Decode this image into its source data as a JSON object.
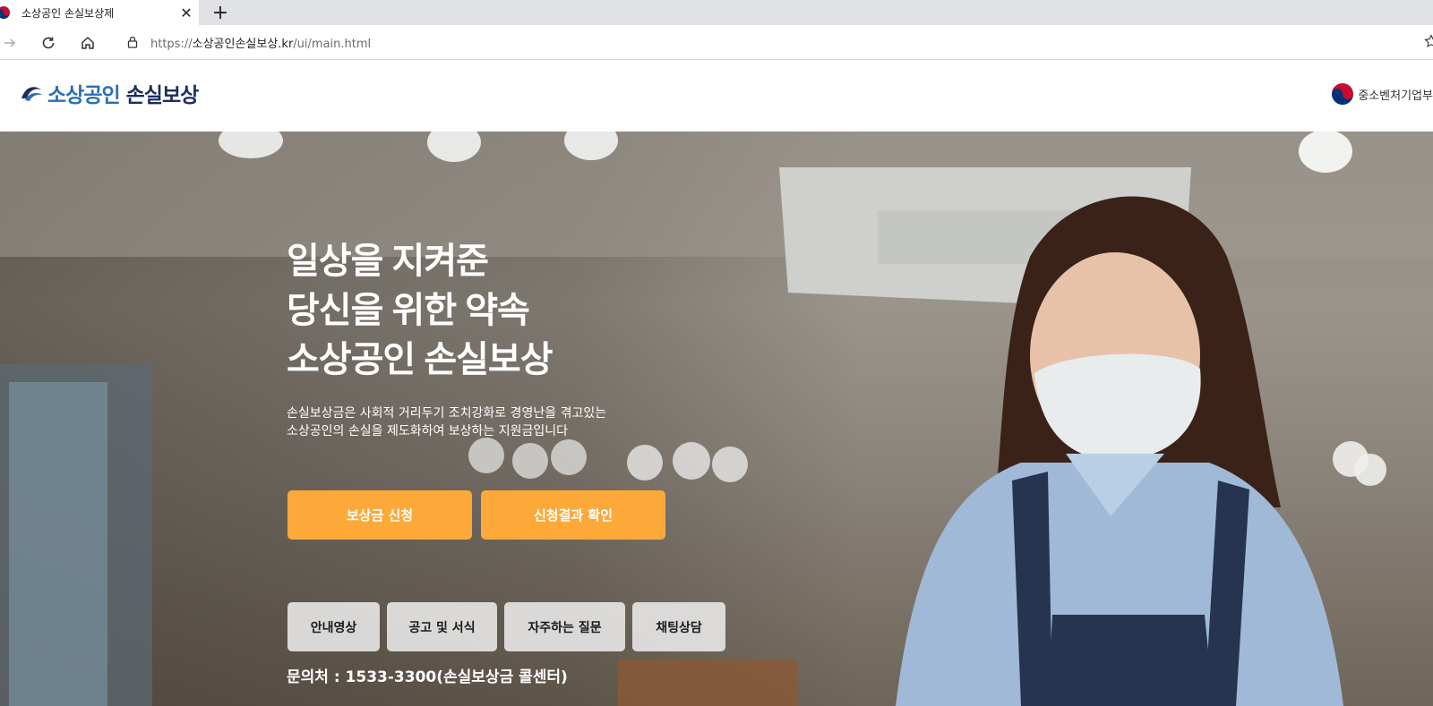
{
  "browser": {
    "tab_title": "소상공인 손실보상제",
    "url_scheme": "https://",
    "url_host": "소상공인손실보상.kr",
    "url_path": "/ui/main.html"
  },
  "header": {
    "logo_part1": "소상공인",
    "logo_part2": "손실보상",
    "ministry": "중소벤처기업부"
  },
  "hero": {
    "title_lines": [
      "일상을 지켜준",
      "당신을 위한 약속",
      "소상공인 손실보상"
    ],
    "desc_lines": [
      "손실보상금은 사회적 거리두기 조치강화로 경영난을 겪고있는",
      "소상공인의 손실을 제도화하여 보상하는 지원금입니다"
    ],
    "cta": [
      "보상금 신청",
      "신청결과 확인"
    ],
    "quick_links": [
      "안내영상",
      "공고 및 서식",
      "자주하는 질문",
      "채팅상담"
    ],
    "contact": "문의처 : 1533-3300(손실보상금 콜센터)"
  },
  "colors": {
    "cta": "#fca93a",
    "logo_blue": "#2a6fb4",
    "logo_navy": "#1b2d5e"
  }
}
